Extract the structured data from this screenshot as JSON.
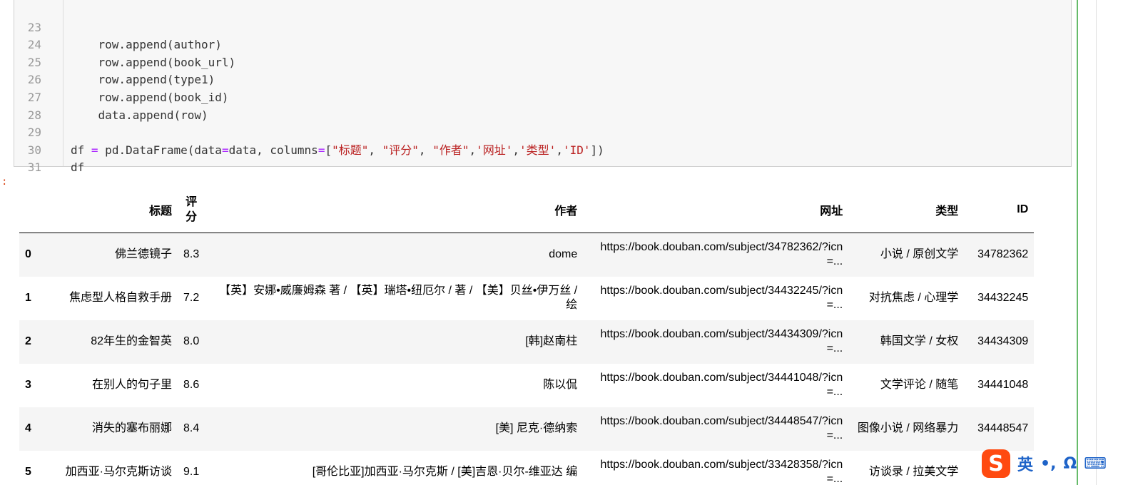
{
  "code": {
    "lines": [
      {
        "num": "23",
        "text": "    row.append(author)"
      },
      {
        "num": "24",
        "text": "    row.append(book_url)"
      },
      {
        "num": "25",
        "text": "    row.append(type1)"
      },
      {
        "num": "26",
        "text": "    row.append(book_id)"
      },
      {
        "num": "27",
        "text": "    data.append(row)"
      },
      {
        "num": "28",
        "text": ""
      },
      {
        "num": "29",
        "pre": "df ",
        "op": "=",
        "mid": " pd.DataFrame(data",
        "op2": "=",
        "mid2": "data, columns",
        "op3": "=",
        "mid3": "[",
        "s1": "\"标题\"",
        "c1": ", ",
        "s2": "\"评分\"",
        "c2": ", ",
        "s3": "\"作者\"",
        "c3": ",",
        "s4": "'网址'",
        "c4": ",",
        "s5": "'类型'",
        "c5": ",",
        "s6": "'ID'",
        "end": "])"
      },
      {
        "num": "30",
        "text": "df"
      },
      {
        "num": "31",
        "text": ""
      }
    ]
  },
  "output": {
    "prompt": ":"
  },
  "dataframe": {
    "columns": [
      "标题",
      "评分",
      "作者",
      "网址",
      "类型",
      "ID"
    ],
    "rows": [
      {
        "index": "0",
        "title": "佛兰德镜子",
        "rating": "8.3",
        "author": "dome",
        "url": "https://book.douban.com/subject/34782362/?icn=...",
        "type": "小说 / 原创文学",
        "id": "34782362"
      },
      {
        "index": "1",
        "title": "焦虑型人格自救手册",
        "rating": "7.2",
        "author": "【英】安娜•威廉姆森 著 / 【英】瑞塔•纽厄尔 / 著 / 【美】贝丝•伊万丝 / 绘",
        "url": "https://book.douban.com/subject/34432245/?icn=...",
        "type": "对抗焦虑 / 心理学",
        "id": "34432245"
      },
      {
        "index": "2",
        "title": "82年生的金智英",
        "rating": "8.0",
        "author": "[韩]赵南柱",
        "url": "https://book.douban.com/subject/34434309/?icn=...",
        "type": "韩国文学 / 女权",
        "id": "34434309"
      },
      {
        "index": "3",
        "title": "在别人的句子里",
        "rating": "8.6",
        "author": "陈以侃",
        "url": "https://book.douban.com/subject/34441048/?icn=...",
        "type": "文学评论 / 随笔",
        "id": "34441048"
      },
      {
        "index": "4",
        "title": "消失的塞布丽娜",
        "rating": "8.4",
        "author": "[美] 尼克·德纳索",
        "url": "https://book.douban.com/subject/34448547/?icn=...",
        "type": "图像小说 / 网络暴力",
        "id": "34448547"
      },
      {
        "index": "5",
        "title": "加西亚·马尔克斯访谈",
        "rating": "9.1",
        "author": "[哥伦比亚]加西亚·马尔克斯 / [美]吉恩·贝尔-维亚达 编",
        "url": "https://book.douban.com/subject/33428358/?icn=...",
        "type": "访谈录 / 拉美文学",
        "id": ""
      }
    ]
  },
  "ime": {
    "logo": "S",
    "mode": "英",
    "punct": "•,",
    "symbol": "Ω",
    "keyboard": "⌨"
  }
}
